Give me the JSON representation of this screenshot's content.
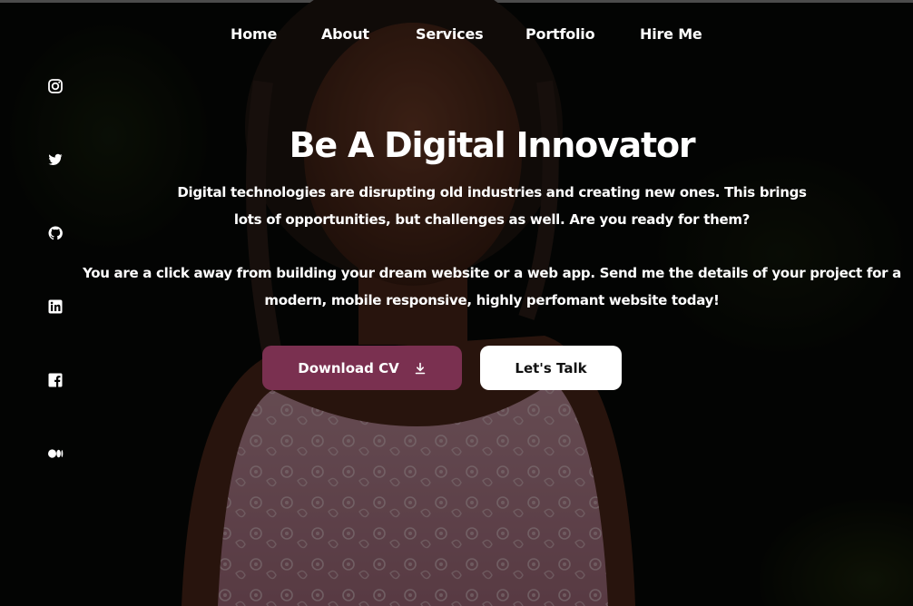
{
  "nav": {
    "items": [
      {
        "label": "Home"
      },
      {
        "label": "About"
      },
      {
        "label": "Services"
      },
      {
        "label": "Portfolio"
      },
      {
        "label": "Hire Me"
      }
    ]
  },
  "social": {
    "icons": [
      "instagram-icon",
      "twitter-icon",
      "github-icon",
      "linkedin-icon",
      "facebook-icon",
      "medium-icon"
    ]
  },
  "hero": {
    "headline": "Be A Digital Innovator",
    "paragraph1": {
      "line1": "Digital technologies are disrupting old industries and creating new ones. This brings",
      "line2": "lots of opportunities, but challenges as well. Are you ready for them?"
    },
    "paragraph2": {
      "line1": "You are a click away from building your dream website or a web app. Send me the details of your project for a",
      "line2": "modern, mobile responsive, highly perfomant website today!"
    }
  },
  "buttons": {
    "download_cv": "Download CV",
    "lets_talk": "Let's Talk"
  },
  "colors": {
    "accent": "#7a3050",
    "background": "#070906",
    "text": "#ffffff"
  }
}
